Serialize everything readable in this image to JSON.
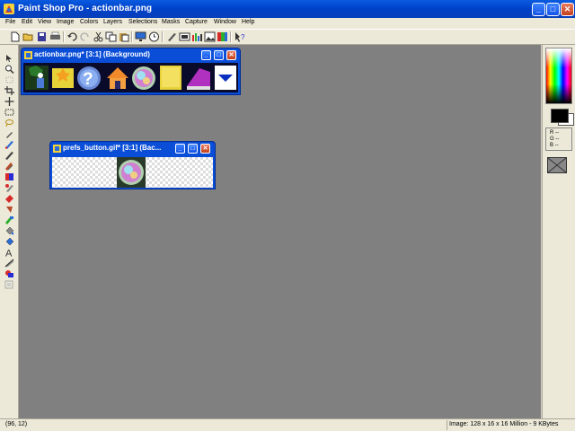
{
  "app": {
    "title": "Paint Shop Pro - actionbar.png"
  },
  "menu": [
    "File",
    "Edit",
    "View",
    "Image",
    "Colors",
    "Layers",
    "Selections",
    "Masks",
    "Capture",
    "Window",
    "Help"
  ],
  "toolbar": {
    "icons": [
      "new-icon",
      "open-icon",
      "save-icon",
      "print-icon",
      "undo-icon",
      "redo-icon",
      "cut-icon",
      "copy-icon",
      "paste-icon",
      "screen-icon",
      "clock-icon",
      "brush-icon",
      "layers-icon",
      "histogram-icon",
      "image-icon",
      "palette-icon",
      "help-icon"
    ]
  },
  "tools": [
    "arrow-tool-icon",
    "zoom-tool-icon",
    "deform-tool-icon",
    "crop-tool-icon",
    "move-tool-icon",
    "selection-tool-icon",
    "lasso-tool-icon",
    "dropper-tool-icon",
    "paintbrush-tool-icon",
    "clone-tool-icon",
    "color-replacer-icon",
    "retouch-tool-icon",
    "scratch-remover-icon",
    "eraser-tool-icon",
    "picture-tube-icon",
    "airbrush-tool-icon",
    "flood-fill-tool-icon",
    "text-tool-icon",
    "line-tool-icon",
    "shape-tool-icon",
    "vector-object-icon"
  ],
  "doc1": {
    "title": "actionbar.png* [3:1] (Background)"
  },
  "doc2": {
    "title": "prefs_button.gif* [3:1] (Bac..."
  },
  "palette": {
    "fg": "#000000",
    "bg": "#ffffff",
    "r": "R --",
    "g": "G --",
    "b": "B --"
  },
  "status": {
    "coords": "(96, 12)",
    "image_info": "Image:  128 x 16 x 16 Million - 9 KBytes"
  },
  "colors": {
    "title_blue": "#0a4ed8",
    "workspace": "#808080",
    "chrome": "#ece9d8"
  }
}
